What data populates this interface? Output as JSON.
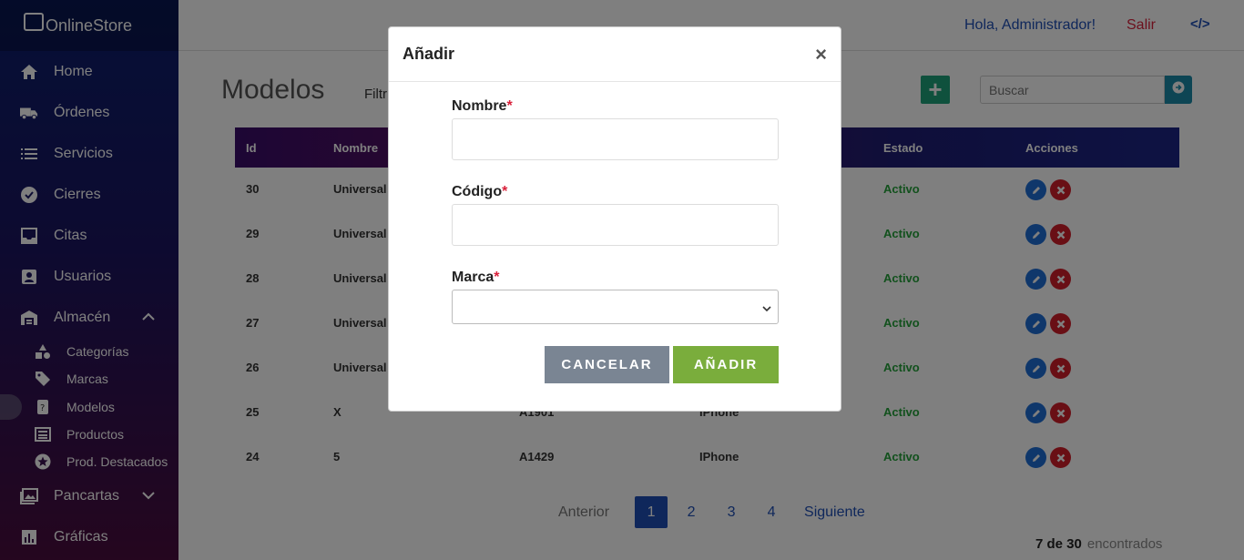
{
  "app": {
    "brand": "OnlineStore"
  },
  "sidebar": {
    "items": [
      {
        "label": "Home",
        "icon": "home-icon"
      },
      {
        "label": "Órdenes",
        "icon": "truck-icon"
      },
      {
        "label": "Servicios",
        "icon": "list-icon"
      },
      {
        "label": "Cierres",
        "icon": "badge-check-icon"
      },
      {
        "label": "Citas",
        "icon": "inbox-icon"
      },
      {
        "label": "Usuarios",
        "icon": "user-card-icon"
      },
      {
        "label": "Almacén",
        "icon": "warehouse-icon",
        "expanded": true
      }
    ],
    "sub_items": [
      {
        "label": "Categorías",
        "icon": "shapes-icon"
      },
      {
        "label": "Marcas",
        "icon": "tag-icon"
      },
      {
        "label": "Modelos",
        "icon": "phone-icon",
        "active": true
      },
      {
        "label": "Productos",
        "icon": "list-alt-icon"
      },
      {
        "label": "Prod. Destacados",
        "icon": "star-icon"
      }
    ],
    "after_items": [
      {
        "label": "Pancartas",
        "icon": "image-icon"
      },
      {
        "label": "Gráficas",
        "icon": "chart-icon"
      }
    ]
  },
  "header": {
    "greeting": "Hola, Administrador!",
    "logout": "Salir"
  },
  "main": {
    "title": "Modelos",
    "filter_label": "Filtr",
    "search_placeholder": "Buscar",
    "columns": [
      "Id",
      "Nombre",
      "Estado",
      "Acciones"
    ],
    "rows": [
      {
        "id": "30",
        "nombre": "Universal",
        "codigo": "",
        "marca": "",
        "estado": "Activo"
      },
      {
        "id": "29",
        "nombre": "Universal",
        "codigo": "",
        "marca": "",
        "estado": "Activo"
      },
      {
        "id": "28",
        "nombre": "Universal",
        "codigo": "",
        "marca": "",
        "estado": "Activo"
      },
      {
        "id": "27",
        "nombre": "Universal",
        "codigo": "",
        "marca": "",
        "estado": "Activo"
      },
      {
        "id": "26",
        "nombre": "Universal",
        "codigo": "",
        "marca": "",
        "estado": "Activo"
      },
      {
        "id": "25",
        "nombre": "X",
        "codigo": "A1901",
        "marca": "IPhone",
        "estado": "Activo"
      },
      {
        "id": "24",
        "nombre": "5",
        "codigo": "A1429",
        "marca": "IPhone",
        "estado": "Activo"
      }
    ],
    "pagination": {
      "prev": "Anterior",
      "pages": [
        "1",
        "2",
        "3",
        "4"
      ],
      "current": "1",
      "next": "Siguiente"
    },
    "count": {
      "value": "7 de 30",
      "label": "encontrados"
    }
  },
  "modal": {
    "title": "Añadir",
    "close": "×",
    "fields": [
      {
        "label": "Nombre",
        "required": "*",
        "value": ""
      },
      {
        "label": "Código",
        "required": "*",
        "value": ""
      },
      {
        "label": "Marca",
        "required": "*",
        "value": ""
      }
    ],
    "cancel_label": "CANCELAR",
    "submit_label": "AÑADIR"
  },
  "colors": {
    "accent": "#1f4fb6",
    "submit": "#7aad3c",
    "cancel": "#7a8593",
    "status": "#25a33a",
    "danger": "#d31e2a"
  }
}
